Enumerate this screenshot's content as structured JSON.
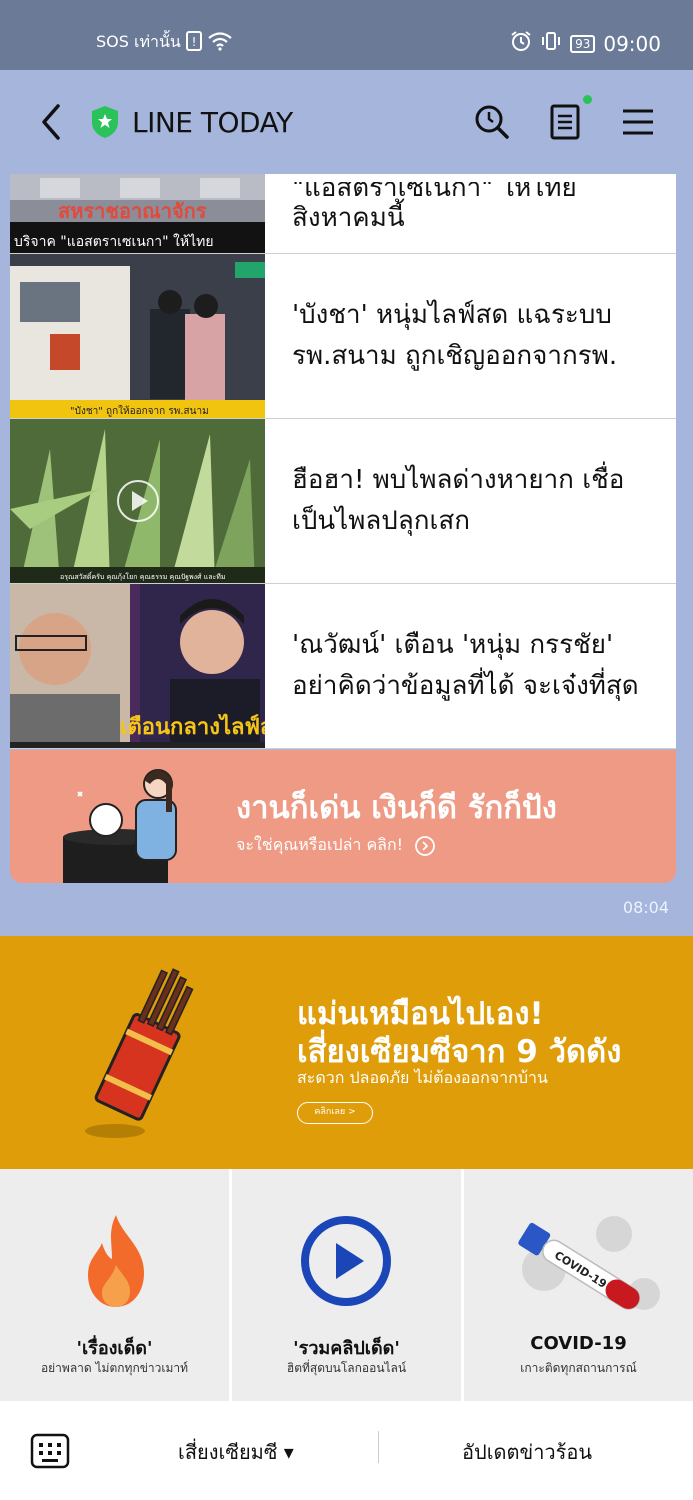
{
  "status_bar": {
    "carrier": "SOS เท่านั้น",
    "battery": "93",
    "time": "09:00"
  },
  "header": {
    "title": "LINE TODAY"
  },
  "news": [
    {
      "line1": "\"แอสตร้าเซเนก้า\" ให้ไทย",
      "line2": "สิงหาคมนี้",
      "thumb_text1": "สหราชอาณาจักร",
      "thumb_text2": "บริจาค \"แอสตราเซเนกา\" ให้ไทย"
    },
    {
      "headline": "'บังชา' หนุ่มไลฟ์สด แฉระบบรพ.สนาม ถูกเชิญออกจากรพ.",
      "thumb_text": "\"บังชา\" ถูกให้ออกจาก รพ.สนาม"
    },
    {
      "headline": "ฮือฮา! พบไพลด่างหายาก เชื่อเป็นไพลปลุกเสก",
      "thumb_text": "อรุณสวัสดิ์ครับ คุณกุ้งโยก คุณธรรม คุณปัฐพงศ์ และทีม"
    },
    {
      "headline": "'ณวัฒน์' เตือน 'หนุ่ม กรรชัย' อย่าคิดว่าข้อมูลที่ได้ จะเจ๋งที่สุด",
      "thumb_text": "เตือนกลางไลฟ์ส"
    }
  ],
  "promo_card": {
    "title": "งานก็เด่น เงินก็ดี รักก็ปัง",
    "subtitle": "จะใช่คุณหรือเปล่า คลิก!"
  },
  "message_time": "08:04",
  "banner": {
    "line1": "แม่นเหมือนไปเอง!",
    "line2": "เสี่ยงเซียมซีจาก 9 วัดดัง",
    "line3": "สะดวก ปลอดภัย ไม่ต้องออกจากบ้าน",
    "button": "คลิกเลย >"
  },
  "tiles": [
    {
      "title": "'เรื่องเด็ด'",
      "subtitle": "อย่าพลาด ไม่ตกทุกข่าวเมาท์"
    },
    {
      "title": "'รวมคลิปเด็ด'",
      "subtitle": "ฮิตที่สุดบนโลกออนไลน์"
    },
    {
      "title": "COVID-19",
      "subtitle": "เกาะติดทุกสถานการณ์",
      "tube_label": "COVID-19"
    }
  ],
  "bottom_bar": {
    "menu1": "เสี่ยงเซียมซี ▾",
    "menu2": "อัปเดตข่าวร้อน"
  },
  "colors": {
    "header_bg": "#a5b5dc",
    "status_bg": "#6b7a96",
    "promo_card_bg": "#ef9a84",
    "banner_bg": "#df9d09",
    "accent_green": "#29c35a"
  }
}
